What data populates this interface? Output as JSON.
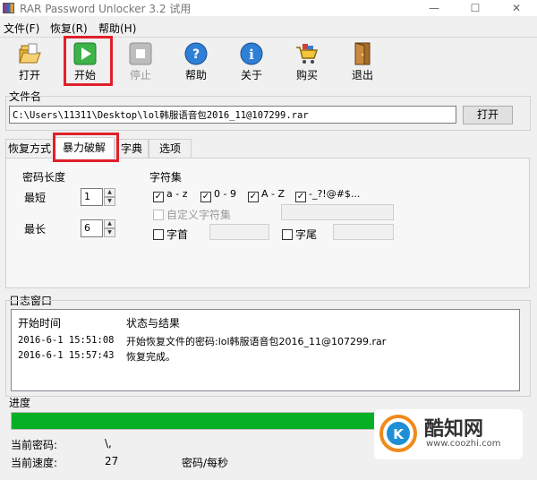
{
  "window": {
    "title": "RAR Password Unlocker 3.2 试用",
    "controls": [
      "—",
      "☐",
      "✕"
    ]
  },
  "menu": [
    "文件(F)",
    "恢复(R)",
    "帮助(H)"
  ],
  "toolbar": [
    {
      "label": "打开",
      "icon": "folder-open-icon",
      "enabled": true
    },
    {
      "label": "开始",
      "icon": "play-icon",
      "enabled": true
    },
    {
      "label": "停止",
      "icon": "stop-icon",
      "enabled": false
    },
    {
      "label": "帮助",
      "icon": "help-icon",
      "enabled": true
    },
    {
      "label": "关于",
      "icon": "info-icon",
      "enabled": true
    },
    {
      "label": "购买",
      "icon": "cart-icon",
      "enabled": true
    },
    {
      "label": "退出",
      "icon": "exit-door-icon",
      "enabled": true
    }
  ],
  "file": {
    "label": "文件名",
    "path": "C:\\Users\\11311\\Desktop\\lol韩服语音包2016_11@107299.rar",
    "open_button": "打开"
  },
  "tabs": [
    "恢复方式",
    "暴力破解",
    "字典",
    "选项"
  ],
  "active_tab": "暴力破解",
  "brute_force": {
    "length_label": "密码长度",
    "min_label": "最短",
    "min_value": "1",
    "max_label": "最长",
    "max_value": "6",
    "charset_label": "字符集",
    "charsets": [
      {
        "label": "a - z",
        "checked": true
      },
      {
        "label": "0 - 9",
        "checked": true
      },
      {
        "label": "A - Z",
        "checked": true
      },
      {
        "label": "-_?!@#$...",
        "checked": true
      }
    ],
    "custom_charset": {
      "label": "自定义字符集",
      "checked": false,
      "enabled": false
    },
    "prefix": {
      "label": "字首",
      "checked": false
    },
    "suffix": {
      "label": "字尾",
      "checked": false
    }
  },
  "log": {
    "label": "日志窗口",
    "col_time": "开始时间",
    "col_status": "状态与结果",
    "rows": [
      {
        "time": "2016-6-1  15:51:08",
        "status": "开始恢复文件的密码:lol韩服语音包2016_11@107299.rar"
      },
      {
        "time": "2016-6-1  15:57:43",
        "status": "恢复完成。"
      }
    ]
  },
  "progress": {
    "label": "进度",
    "value": 1.0,
    "color": "#06b025"
  },
  "current_password": {
    "label": "当前密码:",
    "value": "\\,"
  },
  "current_speed": {
    "label": "当前速度:",
    "value": "27",
    "unit": "密码/每秒"
  },
  "watermark": {
    "text": "酷知网",
    "url": "www.coozhi.com"
  },
  "highlight_color": "#e0202a"
}
